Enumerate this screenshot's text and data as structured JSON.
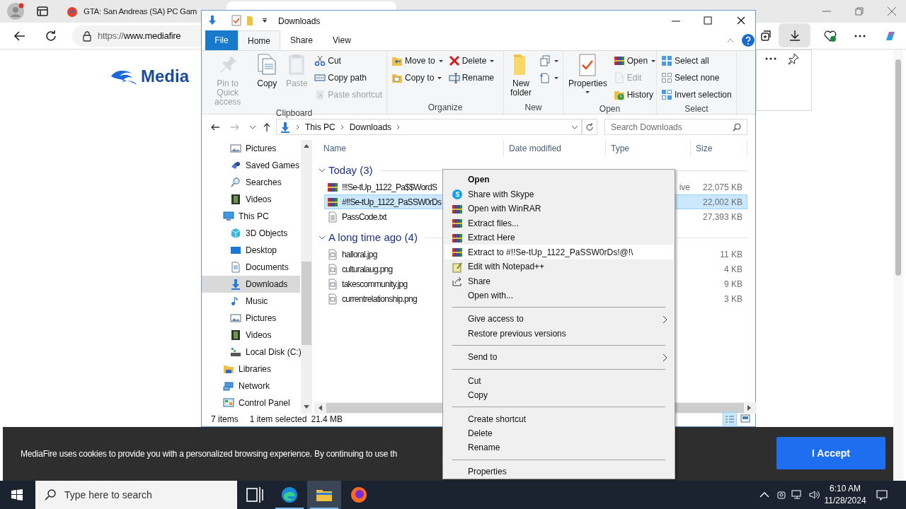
{
  "browser": {
    "tabs": [
      {
        "title": "GTA: San Andreas (SA) PC Gam",
        "selected": false
      },
      {
        "selected": true
      }
    ],
    "url_scheme": "https://",
    "url_host": "www.mediafire"
  },
  "page": {
    "logo": "Media",
    "cookie_text": "MediaFire uses cookies to provide you with a personalized browsing experience. By continuing to use th",
    "accept_button": "I Accept"
  },
  "explorer": {
    "title": "Downloads",
    "ribbon_tabs": [
      {
        "label": "File",
        "kind": "file",
        "selected": false
      },
      {
        "label": "Home",
        "kind": "tab",
        "selected": true
      },
      {
        "label": "Share",
        "kind": "tab",
        "selected": false
      },
      {
        "label": "View",
        "kind": "tab",
        "selected": false
      }
    ],
    "ribbon_groups": [
      {
        "label": "Clipboard",
        "columns": [
          [
            {
              "label": "Pin to Quick access",
              "kind": "large",
              "disabled": true,
              "dropdown": false
            }
          ],
          [
            {
              "label": "Copy",
              "kind": "large",
              "disabled": false,
              "dropdown": false
            }
          ],
          [
            {
              "label": "Paste",
              "kind": "large",
              "disabled": true,
              "dropdown": false
            }
          ],
          [
            {
              "label": "Cut",
              "kind": "small",
              "disabled": false,
              "dropdown": false
            },
            {
              "label": "Copy path",
              "kind": "small",
              "disabled": false,
              "dropdown": false
            },
            {
              "label": "Paste shortcut",
              "kind": "small",
              "disabled": true,
              "dropdown": false
            }
          ]
        ]
      },
      {
        "label": "Organize",
        "columns": [
          [
            {
              "label": "Move to",
              "kind": "small",
              "disabled": false,
              "dropdown": true
            },
            {
              "label": "Copy to",
              "kind": "small",
              "disabled": false,
              "dropdown": true
            }
          ],
          [
            {
              "label": "Delete",
              "kind": "small",
              "disabled": false,
              "dropdown": true
            },
            {
              "label": "Rename",
              "kind": "small",
              "disabled": false,
              "dropdown": false
            }
          ]
        ]
      },
      {
        "label": "New",
        "columns": [
          [
            {
              "label": "New folder",
              "kind": "large",
              "disabled": false,
              "dropdown": false
            }
          ],
          [
            {
              "kind": "small",
              "disabled": false,
              "dropdown": true
            },
            {
              "kind": "small",
              "disabled": false,
              "dropdown": true
            }
          ]
        ]
      },
      {
        "label": "Open",
        "columns": [
          [
            {
              "label": "Properties",
              "kind": "large",
              "disabled": false,
              "dropdown": true
            }
          ],
          [
            {
              "label": "Open",
              "kind": "small",
              "disabled": false,
              "dropdown": true
            },
            {
              "label": "Edit",
              "kind": "small",
              "disabled": true,
              "dropdown": false
            },
            {
              "label": "History",
              "kind": "small",
              "disabled": false,
              "dropdown": false
            }
          ]
        ]
      },
      {
        "label": "Select",
        "columns": [
          [
            {
              "label": "Select all",
              "kind": "small",
              "disabled": false,
              "dropdown": false
            },
            {
              "label": "Select none",
              "kind": "small",
              "disabled": false,
              "dropdown": false
            },
            {
              "label": "Invert selection",
              "kind": "small",
              "disabled": false,
              "dropdown": false
            }
          ]
        ]
      }
    ],
    "breadcrumb": [
      "This PC",
      "Downloads"
    ],
    "search": {
      "placeholder": "Search Downloads"
    },
    "nav_pane": {
      "scrolled_items": [
        {
          "label": "Pictures",
          "selected": false
        },
        {
          "label": "Saved Games",
          "selected": false
        },
        {
          "label": "Searches",
          "selected": false
        },
        {
          "label": "Videos",
          "selected": false
        }
      ],
      "tree": [
        {
          "label": "This PC",
          "selected": false,
          "children": [
            {
              "label": "3D Objects",
              "selected": false
            },
            {
              "label": "Desktop",
              "selected": false
            },
            {
              "label": "Documents",
              "selected": false
            },
            {
              "label": "Downloads",
              "selected": true
            },
            {
              "label": "Music",
              "selected": false
            },
            {
              "label": "Pictures",
              "selected": false
            },
            {
              "label": "Videos",
              "selected": false
            },
            {
              "label": "Local Disk (C:)",
              "selected": false
            }
          ]
        },
        {
          "label": "Libraries",
          "selected": false
        },
        {
          "label": "Network",
          "selected": false
        },
        {
          "label": "Control Panel",
          "selected": false
        }
      ]
    },
    "columns": [
      "Name",
      "Date modified",
      "Type",
      "Size"
    ],
    "groups": [
      {
        "label": "Today (3)",
        "expanded": true,
        "files": [
          {
            "name": "!!!Se-tUp_1122_Pa$$WordS",
            "kind": "archive",
            "type": "ive",
            "size": "22,075 KB",
            "selected": false
          },
          {
            "name": "#!!Se-tUp_1122_PaSSW0rDs",
            "kind": "archive",
            "size": "22,002 KB",
            "selected": true
          },
          {
            "name": "PassCode.txt",
            "kind": "text",
            "size": "27,393 KB",
            "selected": false
          }
        ]
      },
      {
        "label": "A long time ago (4)",
        "expanded": true,
        "files": [
          {
            "name": "halloral.jpg",
            "kind": "image",
            "size": "11 KB",
            "selected": false
          },
          {
            "name": "culturalaug.png",
            "kind": "image",
            "size": "4 KB",
            "selected": false
          },
          {
            "name": "takescommunity.jpg",
            "kind": "image",
            "size": "9 KB",
            "selected": false
          },
          {
            "name": "currentrelationship.png",
            "kind": "image",
            "size": "3 KB",
            "selected": false
          }
        ]
      }
    ],
    "status": {
      "count": "7 items",
      "selection": "1 item selected",
      "selection_size": "21.4 MB"
    }
  },
  "context_menu": [
    {
      "kind": "item",
      "label": "Open",
      "default": true,
      "submenu": false,
      "selected": false
    },
    {
      "kind": "item",
      "label": "Share with Skype",
      "default": false,
      "submenu": false,
      "selected": false
    },
    {
      "kind": "item",
      "label": "Open with WinRAR",
      "default": false,
      "submenu": false,
      "selected": false
    },
    {
      "kind": "item",
      "label": "Extract files...",
      "default": false,
      "submenu": false,
      "selected": false
    },
    {
      "kind": "item",
      "label": "Extract Here",
      "default": false,
      "submenu": false,
      "selected": false
    },
    {
      "kind": "item",
      "label": "Extract to #!!Se-tUp_1122_PaSSW0rDs!@!\\",
      "default": false,
      "submenu": false,
      "selected": true
    },
    {
      "kind": "item",
      "label": "Edit with Notepad++",
      "default": false,
      "submenu": false,
      "selected": false
    },
    {
      "kind": "item",
      "label": "Share",
      "default": false,
      "submenu": false,
      "selected": false
    },
    {
      "kind": "item",
      "label": "Open with...",
      "default": false,
      "submenu": false,
      "selected": false
    },
    {
      "kind": "separator"
    },
    {
      "kind": "item",
      "label": "Give access to",
      "default": false,
      "submenu": true,
      "selected": false
    },
    {
      "kind": "item",
      "label": "Restore previous versions",
      "default": false,
      "submenu": false,
      "selected": false
    },
    {
      "kind": "separator"
    },
    {
      "kind": "item",
      "label": "Send to",
      "default": false,
      "submenu": true,
      "selected": false
    },
    {
      "kind": "separator"
    },
    {
      "kind": "item",
      "label": "Cut",
      "default": false,
      "submenu": false,
      "selected": false
    },
    {
      "kind": "item",
      "label": "Copy",
      "default": false,
      "submenu": false,
      "selected": false
    },
    {
      "kind": "separator"
    },
    {
      "kind": "item",
      "label": "Create shortcut",
      "default": false,
      "submenu": false,
      "selected": false
    },
    {
      "kind": "item",
      "label": "Delete",
      "default": false,
      "submenu": false,
      "selected": false
    },
    {
      "kind": "item",
      "label": "Rename",
      "default": false,
      "submenu": false,
      "selected": false
    },
    {
      "kind": "separator"
    },
    {
      "kind": "item",
      "label": "Properties",
      "default": false,
      "submenu": false,
      "selected": false
    }
  ],
  "taskbar": {
    "search_placeholder": "Type here to search",
    "apps": [
      {
        "running": false,
        "selected": false
      },
      {
        "running": true,
        "selected": false
      },
      {
        "running": true,
        "selected": true
      },
      {
        "running": false,
        "selected": false
      }
    ],
    "time": "6:10 AM",
    "date": "11/28/2024"
  }
}
